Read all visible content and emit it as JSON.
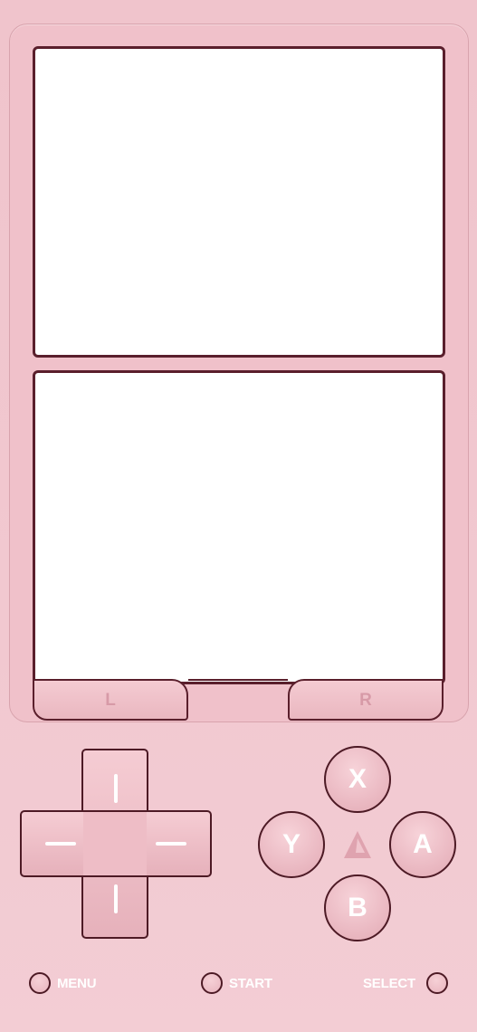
{
  "colors": {
    "body": "#f0c5cd",
    "outline": "#5a1f2c",
    "screen": "#ffffff",
    "label_text": "#ffffff",
    "shoulder_text": "#d79aa7"
  },
  "screens": {
    "top": {
      "icon": "top-screen"
    },
    "bottom": {
      "icon": "touch-screen"
    }
  },
  "shoulders": {
    "left_label": "L",
    "right_label": "R"
  },
  "dpad": {
    "icon": "dpad-icon"
  },
  "face_buttons": {
    "x": "X",
    "y": "Y",
    "a": "A",
    "b": "B"
  },
  "logo": {
    "icon": "delta-logo-icon"
  },
  "system_buttons": {
    "menu": "MENU",
    "start": "START",
    "select": "SELECT"
  }
}
